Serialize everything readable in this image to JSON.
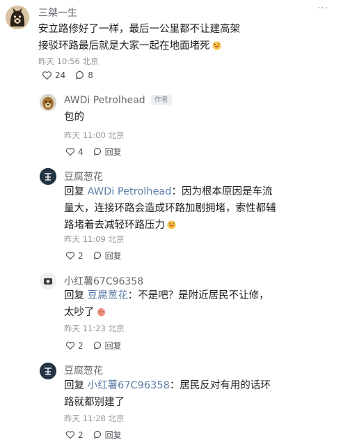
{
  "comments": [
    {
      "name": "三桀一生",
      "text": "安立路修好了一样，最后一公里都不让建高架接驳环路最后就是大家一起在地面堵死",
      "time": "昨天 10:56 北京",
      "likes": "24",
      "replies": "8"
    },
    {
      "name": "AWDi Petrolhead",
      "author_tag": "作者",
      "text": "包的",
      "time": "昨天 11:00 北京",
      "likes": "4",
      "reply_label": "回复"
    },
    {
      "name": "豆腐葱花",
      "reply_prefix": "回复",
      "reply_to": "AWDi Petrolhead",
      "text": "：因为根本原因是车流量大，连接环路会造成环路加剧拥堵，索性都辅路堵着去减轻环路压力",
      "time": "昨天 11:09 北京",
      "likes": "2",
      "reply_label": "回复"
    },
    {
      "name": "小红薯67C96358",
      "reply_prefix": "回复",
      "reply_to": "豆腐葱花",
      "text": "：不是吧？是附近居民不让修，太吵了",
      "time": "昨天 11:23 北京",
      "likes": "2",
      "reply_label": "回复"
    },
    {
      "name": "豆腐葱花",
      "reply_prefix": "回复",
      "reply_to": "小红薯67C96358",
      "text": "：居民反对有用的话环路就都别建了",
      "time": "昨天 11:28 北京",
      "likes": "2",
      "reply_label": "回复"
    }
  ],
  "more_glyph": "···",
  "colors": {
    "mention": "#5b7ea8",
    "meta": "#8f949a",
    "name": "#666a70"
  }
}
